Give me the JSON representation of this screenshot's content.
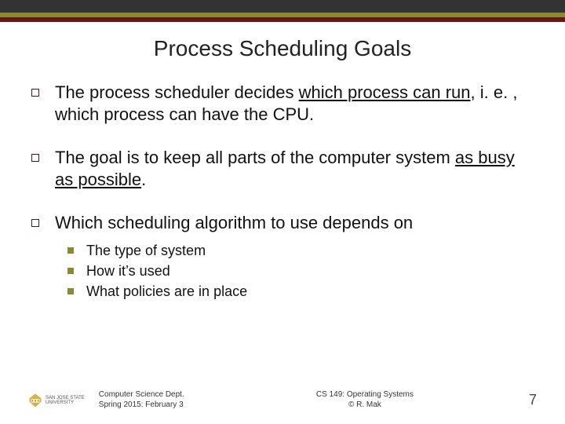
{
  "title": "Process Scheduling Goals",
  "bullets": {
    "b1": {
      "seg1": "The process scheduler decides ",
      "u1": "which process can run",
      "seg2": ", i. e. , which process can have the CPU."
    },
    "b2": {
      "seg1": "The goal is to keep all parts of the computer system ",
      "u1": "as busy as possible",
      "seg2": "."
    },
    "b3": {
      "text": "Which scheduling algorithm to use depends on",
      "subs": {
        "s1": "The type of system",
        "s2": "How it’s used",
        "s3": "What policies are in place"
      }
    }
  },
  "footer": {
    "logo_name": "San Jose State University",
    "col1_line1": "Computer Science Dept.",
    "col1_line2": "Spring 2015: February 3",
    "col2_line1": "CS 149: Operating Systems",
    "col2_line2": "© R. Mak",
    "page": "7"
  }
}
